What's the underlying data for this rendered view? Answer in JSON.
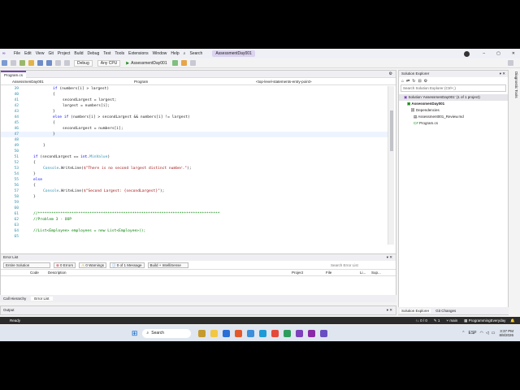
{
  "menu": {
    "items": [
      "File",
      "Edit",
      "View",
      "Git",
      "Project",
      "Build",
      "Debug",
      "Test",
      "Tools",
      "Extensions",
      "Window",
      "Help"
    ],
    "search_label": "Search",
    "solution_title": "AssessmentDay001"
  },
  "toolbar": {
    "config": "Debug",
    "platform": "Any CPU",
    "run_label": "AssessmentDay001"
  },
  "editor": {
    "tab_label": "AssessmenDay001",
    "tab_file": "Program.cs",
    "nav_left": "AssessmenDay001",
    "nav_mid": "Program",
    "nav_right": "<top-level-statements-entry-point>",
    "lines": [
      {
        "n": "39",
        "indent": 2,
        "text": "if (numbers[i] > largest)"
      },
      {
        "n": "40",
        "indent": 2,
        "text": "{"
      },
      {
        "n": "41",
        "indent": 3,
        "text": "secondLargest = largest;"
      },
      {
        "n": "42",
        "indent": 3,
        "text": "largest = numbers[i];"
      },
      {
        "n": "43",
        "indent": 2,
        "text": "}"
      },
      {
        "n": "44",
        "indent": 2,
        "text": "else if (numbers[i] > secondLargest && numbers[i] != largest)"
      },
      {
        "n": "45",
        "indent": 2,
        "text": "{"
      },
      {
        "n": "46",
        "indent": 3,
        "text": "secondLargest = numbers[i];"
      },
      {
        "n": "47",
        "indent": 2,
        "text": "}"
      },
      {
        "n": "48",
        "indent": 1,
        "text": ""
      },
      {
        "n": "49",
        "indent": 1,
        "text": "}"
      },
      {
        "n": "50",
        "indent": 0,
        "text": ""
      },
      {
        "n": "51",
        "indent": 0,
        "text": "if (secondLargest == int.MinValue)"
      },
      {
        "n": "52",
        "indent": 0,
        "text": "{"
      },
      {
        "n": "53",
        "indent": 1,
        "text": "Console.WriteLine($\"There is no second largest distinct number.\");"
      },
      {
        "n": "54",
        "indent": 0,
        "text": "}"
      },
      {
        "n": "55",
        "indent": 0,
        "text": "else"
      },
      {
        "n": "56",
        "indent": 0,
        "text": "{"
      },
      {
        "n": "57",
        "indent": 1,
        "text": "Console.WriteLine($\"Second Largest: {secondLargest}\");"
      },
      {
        "n": "58",
        "indent": 0,
        "text": "}"
      },
      {
        "n": "59",
        "indent": 0,
        "text": ""
      },
      {
        "n": "60",
        "indent": 0,
        "text": ""
      },
      {
        "n": "61",
        "indent": 0,
        "text": "//*********************************************************************************"
      },
      {
        "n": "62",
        "indent": 0,
        "text": "//Problem 3 - OOP"
      },
      {
        "n": "63",
        "indent": 0,
        "text": ""
      },
      {
        "n": "64",
        "indent": 0,
        "text": "//List<Employee> employees = new List<Employee>();"
      },
      {
        "n": "65",
        "indent": 0,
        "text": ""
      }
    ],
    "zoom": "100 %",
    "issues": "No issues found",
    "position": "Ln: 47, Ch: 6",
    "spc": "SPC",
    "crlf": "CRLF",
    "encoding": "UTF-8 with BOM"
  },
  "error_list": {
    "title": "Error List",
    "scope": "Entire Solution",
    "errors": "0 Errors",
    "warnings": "0 Warnings",
    "messages": "0 of 1 Message",
    "build": "Build + IntelliSense",
    "search_placeholder": "Search Error List",
    "columns": [
      "Code",
      "Description",
      "Project",
      "File",
      "Li...",
      "Sup..."
    ],
    "tabs": [
      "Call Hierarchy",
      "Error List"
    ]
  },
  "output": {
    "title": "Output"
  },
  "solution_explorer": {
    "title": "Solution Explorer",
    "search_placeholder": "Search Solution Explorer (Ctrl+;)",
    "items": [
      "Solution 'AssessmenDay001' (1 of 1 project)",
      "AssessmenDay001",
      "Dependencies",
      "Assessment001_Review.md",
      "Program.cs"
    ],
    "tabs": [
      "Solution Explorer",
      "Git Changes"
    ],
    "side_tab": "Diagnostic Tools"
  },
  "status": {
    "ready": "Ready",
    "arrows": "0 / 0",
    "pencil": "1",
    "branch": "main",
    "repo": "ProgrammingEveryday"
  },
  "taskbar": {
    "search": "Search",
    "lang": "ESP",
    "time": "3:37 PM",
    "date": "8/8/2026"
  },
  "colors": {
    "accent": "#7b42bc",
    "keyword": "#0000ff",
    "type": "#2b91af",
    "string": "#a31515",
    "comment": "#008000"
  }
}
